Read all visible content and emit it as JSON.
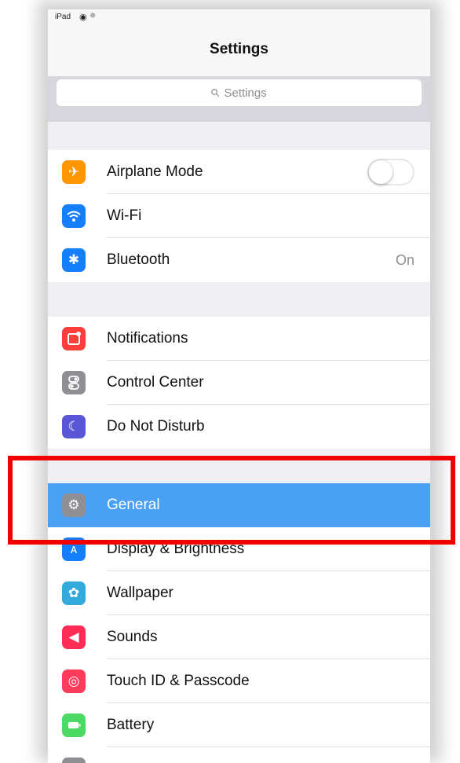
{
  "status_bar": {
    "carrier": "iPad",
    "wifi_icon": "wifi-icon",
    "activity_icon": "loading-spinner-icon"
  },
  "nav": {
    "title": "Settings"
  },
  "search": {
    "placeholder": "Settings",
    "icon": "search-icon"
  },
  "groups": [
    {
      "items": [
        {
          "label": "Airplane Mode",
          "icon": "airplane-icon",
          "icon_color": "#ff9500",
          "accessory": "toggle",
          "toggle_on": false
        },
        {
          "label": "Wi-Fi",
          "icon": "wifi-icon",
          "icon_color": "#147efb"
        },
        {
          "label": "Bluetooth",
          "icon": "bluetooth-icon",
          "icon_color": "#147efb",
          "detail": "On"
        }
      ]
    },
    {
      "items": [
        {
          "label": "Notifications",
          "icon": "notifications-icon",
          "icon_color": "#fc3d39"
        },
        {
          "label": "Control Center",
          "icon": "control-center-icon",
          "icon_color": "#8e8e93"
        },
        {
          "label": "Do Not Disturb",
          "icon": "moon-icon",
          "icon_color": "#5856d6"
        }
      ]
    },
    {
      "items": [
        {
          "label": "General",
          "icon": "gear-icon",
          "icon_color": "#8e8e93",
          "selected": true
        },
        {
          "label": "Display & Brightness",
          "icon": "display-brightness-icon",
          "icon_color": "#147efb"
        },
        {
          "label": "Wallpaper",
          "icon": "wallpaper-icon",
          "icon_color": "#34aadc"
        },
        {
          "label": "Sounds",
          "icon": "sounds-icon",
          "icon_color": "#ff2d55"
        },
        {
          "label": "Touch ID & Passcode",
          "icon": "fingerprint-icon",
          "icon_color": "#ff3b5c"
        },
        {
          "label": "Battery",
          "icon": "battery-icon",
          "icon_color": "#4cd964"
        }
      ]
    }
  ],
  "colors": {
    "selection": "#4aa0f2",
    "highlight_box": "#f20000"
  }
}
